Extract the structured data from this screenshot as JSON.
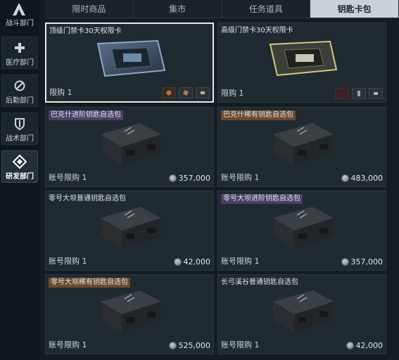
{
  "sidebar": {
    "items": [
      {
        "label": "战斗部门",
        "icon": "combat-icon"
      },
      {
        "label": "医疗部门",
        "icon": "medical-cross-icon"
      },
      {
        "label": "后勤部门",
        "icon": "logistics-icon"
      },
      {
        "label": "战术部门",
        "icon": "shield-icon"
      },
      {
        "label": "研发部门",
        "icon": "research-icon",
        "active": true
      }
    ]
  },
  "tabs": [
    {
      "label": "限时商品"
    },
    {
      "label": "集市"
    },
    {
      "label": "任务道具"
    },
    {
      "label": "钥匙卡包",
      "active": true
    }
  ],
  "cards": [
    {
      "title": "顶级门禁卡30天权限卡",
      "limit": "限购 1",
      "price": "",
      "style": "plain",
      "kind": "keycard-top",
      "selected": true
    },
    {
      "title": "高级门禁卡30天权限卡",
      "limit": "限购 1",
      "price": "",
      "style": "plain",
      "kind": "keycard-high"
    },
    {
      "title": "巴克什进阶钥匙自选包",
      "limit": "账号限购 1",
      "price": "357,000",
      "style": "purple",
      "kind": "case"
    },
    {
      "title": "巴克什稀有钥匙自选包",
      "limit": "账号限购 1",
      "price": "483,000",
      "style": "orange",
      "kind": "case"
    },
    {
      "title": "零号大坝普通钥匙自选包",
      "limit": "账号限购 1",
      "price": "42,000",
      "style": "plain",
      "kind": "case"
    },
    {
      "title": "零号大坝进阶钥匙自选包",
      "limit": "账号限购 1",
      "price": "357,000",
      "style": "purple",
      "kind": "case"
    },
    {
      "title": "零号大坝稀有钥匙自选包",
      "limit": "账号限购 1",
      "price": "525,000",
      "style": "orange",
      "kind": "case"
    },
    {
      "title": "长弓溪谷普通钥匙自选包",
      "limit": "账号限购 1",
      "price": "42,000",
      "style": "plain",
      "kind": "case"
    }
  ],
  "colors": {
    "background": "#141c22",
    "card": "#1f2a31",
    "active_tab": "#c9d1d6",
    "purple_tag": "#4a3f66",
    "orange_tag": "#6b4a2e"
  }
}
